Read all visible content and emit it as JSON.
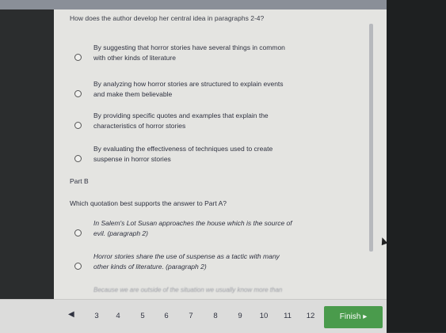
{
  "question1": {
    "prompt": "How does the author develop her central idea in paragraphs 2-4?",
    "choices": [
      {
        "line1": "By suggesting that horror stories have several things in common",
        "line2": "with other kinds of literature"
      },
      {
        "line1": "By analyzing how horror stories are structured to explain events",
        "line2": "and make them believable"
      },
      {
        "line1": "By providing specific quotes and examples that explain the",
        "line2": "characteristics of horror stories"
      },
      {
        "line1": "By evaluating the effectiveness of techniques used to create",
        "line2": "suspense in horror stories"
      }
    ]
  },
  "partB": {
    "label": "Part B",
    "prompt": "Which quotation best supports the answer to Part A?",
    "choices": [
      {
        "line1": "In Salem's Lot Susan approaches the house which is the source of",
        "line2": "evil. (paragraph 2)"
      },
      {
        "line1": "Horror stories share the use of suspense as a tactic with many",
        "line2": "other kinds of literature. (paragraph 2)"
      }
    ],
    "cut_off_text": "Because we are outside of the situation we usually know more than"
  },
  "nav": {
    "prev_icon": "chevron-left-icon",
    "prev_glyph": "◀",
    "pages": [
      "3",
      "4",
      "5",
      "6",
      "7",
      "8",
      "9",
      "10",
      "11",
      "12"
    ],
    "finish_label": "Finish ▸"
  },
  "colors": {
    "finish": "#4a9b4c",
    "panel": "#e4e4e1"
  }
}
